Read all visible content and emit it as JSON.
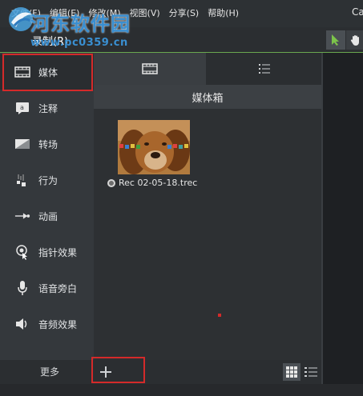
{
  "menu": {
    "items": [
      "文件(F)",
      "编辑(E)",
      "修改(M)",
      "视图(V)",
      "分享(S)",
      "帮助(H)"
    ],
    "title_right": "Ca"
  },
  "watermark": {
    "name": "河东软件园",
    "url": "www.pc0359.cn"
  },
  "toolbar": {
    "record_label": "录制(R)"
  },
  "sidebar": {
    "items": [
      {
        "label": "媒体",
        "icon": "film-icon",
        "selected": true
      },
      {
        "label": "注释",
        "icon": "annotation-icon"
      },
      {
        "label": "转场",
        "icon": "transition-icon"
      },
      {
        "label": "行为",
        "icon": "behavior-icon"
      },
      {
        "label": "动画",
        "icon": "animation-icon"
      },
      {
        "label": "指针效果",
        "icon": "cursor-effect-icon"
      },
      {
        "label": "语音旁白",
        "icon": "microphone-icon"
      },
      {
        "label": "音频效果",
        "icon": "speaker-icon"
      }
    ],
    "more_label": "更多"
  },
  "media_panel": {
    "tabs": [
      "media-bin-tab",
      "library-tab"
    ],
    "header": "媒体箱",
    "clips": [
      {
        "name": "Rec 02-05-18.trec"
      }
    ]
  },
  "colors": {
    "accent_green": "#6aa84f",
    "highlight_red": "#d42a2a",
    "logo_blue": "#3a8fd1"
  }
}
